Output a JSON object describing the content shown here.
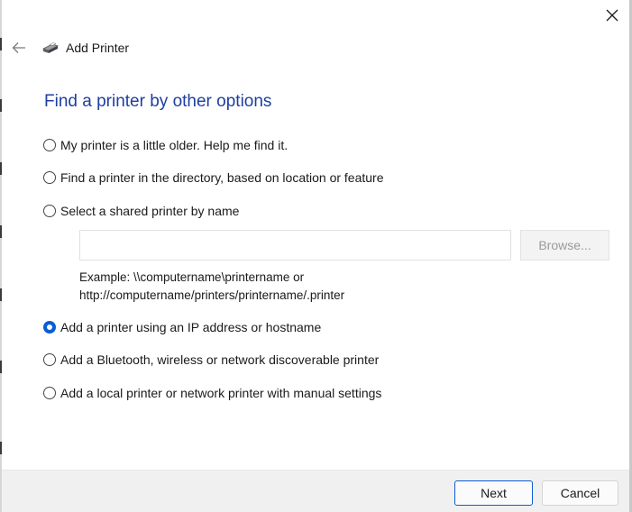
{
  "window": {
    "title": "Add Printer",
    "heading": "Find a printer by other options"
  },
  "options": [
    {
      "label": "My printer is a little older. Help me find it.",
      "checked": false
    },
    {
      "label": "Find a printer in the directory, based on location or feature",
      "checked": false
    },
    {
      "label": "Select a shared printer by name",
      "checked": false
    },
    {
      "label": "Add a printer using an IP address or hostname",
      "checked": true
    },
    {
      "label": "Add a Bluetooth, wireless or network discoverable printer",
      "checked": false
    },
    {
      "label": "Add a local printer or network printer with manual settings",
      "checked": false
    }
  ],
  "shared_printer": {
    "value": "",
    "browse_label": "Browse...",
    "example_line1": "Example: \\\\computername\\printername or",
    "example_line2": "http://computername/printers/printername/.printer"
  },
  "footer": {
    "next_label": "Next",
    "cancel_label": "Cancel"
  },
  "icons": {
    "close": "close-icon",
    "back": "back-arrow-icon",
    "printer": "printer-icon"
  },
  "colors": {
    "heading": "#1e3fa0",
    "accent": "#0b5cd5",
    "footer_bg": "#f0f0f0"
  }
}
